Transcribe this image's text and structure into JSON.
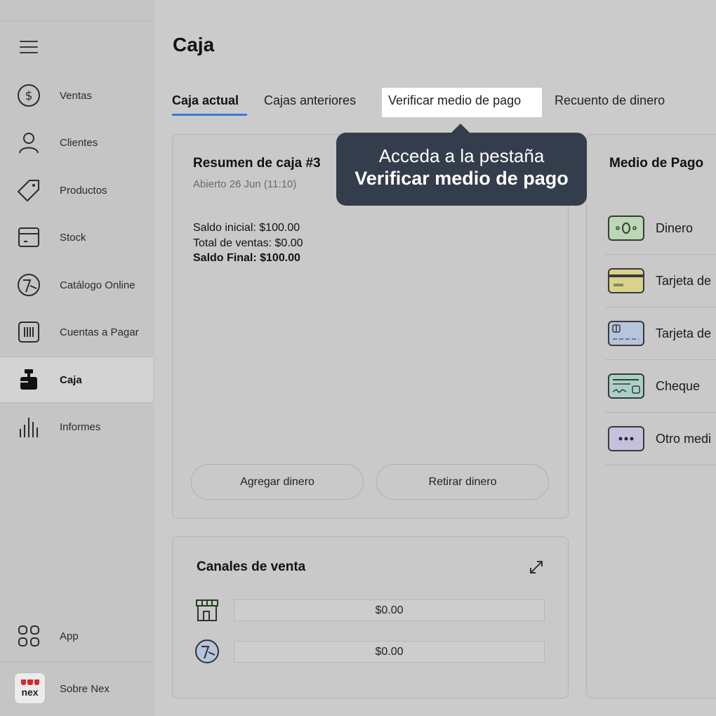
{
  "sidebar": {
    "items": [
      {
        "label": "Ventas",
        "icon": "dollar-circle-icon"
      },
      {
        "label": "Clientes",
        "icon": "user-icon"
      },
      {
        "label": "Productos",
        "icon": "tag-icon"
      },
      {
        "label": "Stock",
        "icon": "box-icon"
      },
      {
        "label": "Catálogo Online",
        "icon": "catalog-icon"
      },
      {
        "label": "Cuentas a Pagar",
        "icon": "barcode-icon"
      },
      {
        "label": "Caja",
        "icon": "cash-register-icon"
      },
      {
        "label": "Informes",
        "icon": "bar-chart-icon"
      }
    ],
    "app_label": "App",
    "about_label": "Sobre Nex",
    "logo_text": "nex"
  },
  "header": {
    "title": "Caja"
  },
  "tabs": [
    {
      "label": "Caja actual"
    },
    {
      "label": "Cajas anteriores"
    },
    {
      "label": "Verificar medio de pago"
    },
    {
      "label": "Recuento de dinero"
    }
  ],
  "summary": {
    "title": "Resumen de caja #3",
    "opened": "Abierto 26 Jun (11:10)",
    "initial_balance": "Saldo inicial: $100.00",
    "total_sales": "Total de ventas: $0.00",
    "final_balance": "Saldo Final: $100.00",
    "add_money": "Agregar dinero",
    "withdraw_money": "Retirar dinero"
  },
  "payment_methods": {
    "title": "Medio de Pago",
    "items": [
      {
        "label": "Dinero",
        "icon": "banknote-icon",
        "color": "#b9d8b3"
      },
      {
        "label": "Tarjeta de",
        "icon": "credit-card-icon",
        "color": "#d8d28e"
      },
      {
        "label": "Tarjeta de",
        "icon": "debit-card-icon",
        "color": "#b6c4dc"
      },
      {
        "label": "Cheque",
        "icon": "cheque-icon",
        "color": "#a9d0c7"
      },
      {
        "label": "Otro medi",
        "icon": "more-icon",
        "color": "#c6c0de"
      }
    ]
  },
  "channels": {
    "title": "Canales de venta",
    "store_value": "$0.00",
    "online_value": "$0.00"
  },
  "tooltip": {
    "line1": "Acceda a la pestaña",
    "line2": "Verificar medio de pago"
  },
  "colors": {
    "accent": "#3a7bd5",
    "tooltip_bg": "#343d4b",
    "brand_red": "#d8262c"
  }
}
